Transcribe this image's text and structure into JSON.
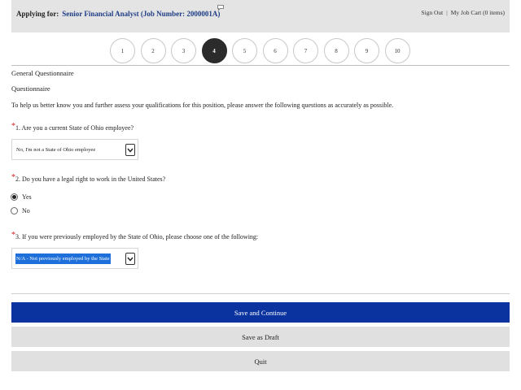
{
  "header": {
    "applying_label": "Applying for:",
    "job_title": "Senior Financial Analyst (Job Number: 2000001A)",
    "sign_out": "Sign Out",
    "separator": "|",
    "job_cart": "My Job Cart (0 items)"
  },
  "steps": {
    "items": [
      "1",
      "2",
      "3",
      "4",
      "5",
      "6",
      "7",
      "8",
      "9",
      "10"
    ],
    "current": "4"
  },
  "form": {
    "section_title": "General Questionnaire",
    "section_subtitle": "Questionnaire",
    "intro": "To help us better know you and further assess your qualifications for this position, please answer the following questions as accurately as possible.",
    "required_marker": "*",
    "q1": {
      "text": "1. Are you a current State of Ohio employee?",
      "selected": "No, I'm not a State of Ohio employee"
    },
    "q2": {
      "text": "2. Do you have a legal right to work in the United States?",
      "options": [
        "Yes",
        "No"
      ],
      "selected": "Yes"
    },
    "q3": {
      "text": "3. If you were previously employed by the State of Ohio, please choose one of the following:",
      "selected": "N/A - Not previously employed by the State"
    }
  },
  "buttons": {
    "save_continue": "Save and Continue",
    "save_draft": "Save as Draft",
    "quit": "Quit"
  },
  "colors": {
    "primary_button": "#0a33a0",
    "job_title": "#1f3d85",
    "required": "#d02020",
    "active_step": "#2b2b2b",
    "selection_highlight": "#1e6fd9"
  },
  "icons": {
    "comment": "speech-bubble-icon",
    "dropdown": "chevron-down-icon"
  }
}
